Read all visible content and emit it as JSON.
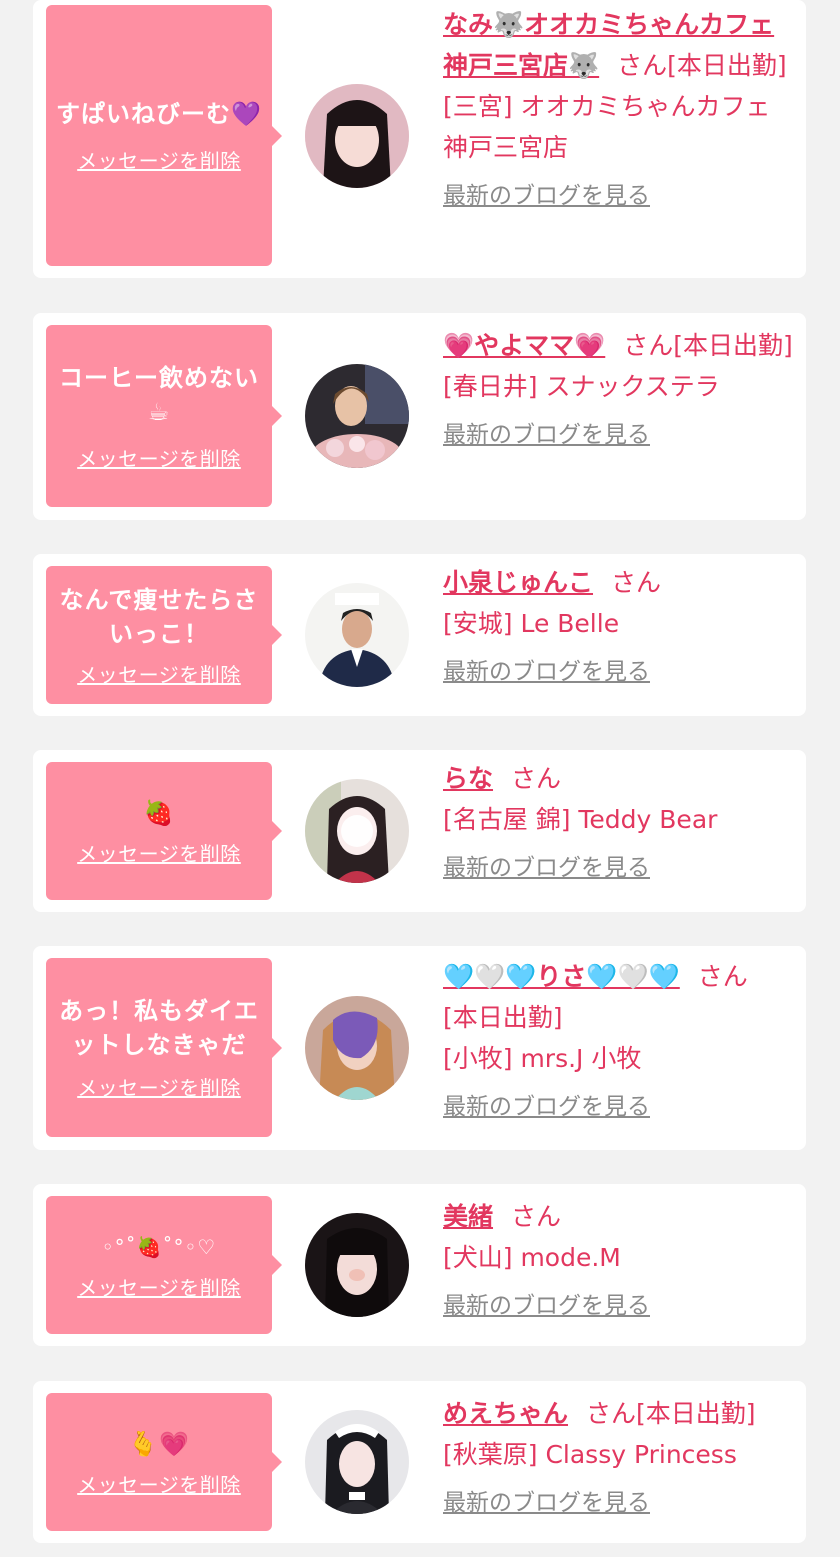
{
  "colors": {
    "accent": "#e2375f",
    "bubble": "#fe8fa2",
    "link_gray": "#8a8a8a",
    "background": "#f2f2f2"
  },
  "delete_label": "メッセージを削除",
  "blog_label": "最新のブログを見る",
  "san_label": "さん",
  "entries": [
    {
      "message": "すぱいねびーむ💜",
      "name": "なみ🐺オオカミちゃんカフェ神戸三宮店🐺",
      "shift": "[本日出勤]",
      "shop": "[三宮] オオカミちゃんカフェ神戸三宮店",
      "avatar": "avatar-photo-girl-bangs"
    },
    {
      "message": "コーヒー飲めない☕",
      "name": "💗やよママ💗",
      "shift": "[本日出勤]",
      "shop": "[春日井] スナックステラ",
      "avatar": "avatar-photo-woman-flowers"
    },
    {
      "message": "なんで痩せたらさいっこ！",
      "name": "小泉じゅんこ",
      "shift": "",
      "shop": "[安城] Le Belle",
      "avatar": "avatar-photo-man-suit"
    },
    {
      "message": "🍓",
      "name": "らな",
      "shift": "",
      "shop": "[名古屋 錦] Teddy Bear",
      "avatar": "avatar-photo-girl-blur"
    },
    {
      "message": "あっ！私もダイエットしなきゃだ",
      "name": "🩵🤍🩵りさ🩵🤍🩵",
      "shift": "[本日出勤]",
      "shop": "[小牧] mrs.J 小牧",
      "avatar": "avatar-photo-girl-stamp"
    },
    {
      "message": "◦°˚🍓˚°◦♡",
      "name": "美緒",
      "shift": "",
      "shop": "[犬山] mode.M",
      "avatar": "avatar-photo-girl-dark"
    },
    {
      "message": "🫰💗",
      "name": "めえちゃん",
      "shift": "[本日出勤]",
      "shop": "[秋葉原] Classy Princess",
      "avatar": "avatar-photo-girl-maid"
    }
  ]
}
